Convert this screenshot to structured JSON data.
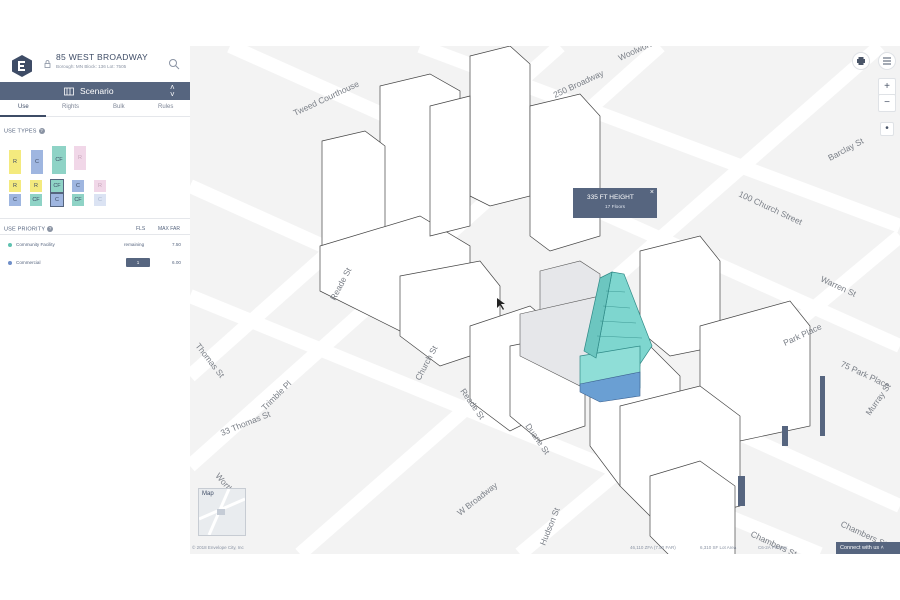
{
  "header": {
    "address": "85 WEST BROADWAY",
    "meta": "Borough: MN   Block: 136   Lot: 7505"
  },
  "scenario": {
    "label": "Scenario"
  },
  "tabs": [
    {
      "label": "Use",
      "active": true
    },
    {
      "label": "Rights",
      "active": false
    },
    {
      "label": "Bulk",
      "active": false
    },
    {
      "label": "Rules",
      "active": false
    }
  ],
  "use_types": {
    "title": "USE TYPES",
    "row1": [
      "R",
      "C",
      "CF",
      "R"
    ],
    "row2_top": [
      "R",
      "R",
      "CF",
      "C",
      "R"
    ],
    "row2_bottom": [
      "C",
      "CF",
      "C",
      "CF",
      "C"
    ]
  },
  "use_priority": {
    "title": "USE PRIORITY",
    "col_flr": "FLS",
    "col_far": "MAX FAR",
    "rows": [
      {
        "name": "Community Facility",
        "value": "remaining",
        "far": "7.50",
        "color": "#5fc2b0"
      },
      {
        "name": "Commercial",
        "value": "1",
        "far": "6.00",
        "color": "#6f8fc8"
      }
    ]
  },
  "tooltip": {
    "height": "335 FT HEIGHT",
    "floors": "17 Floors",
    "close": "×"
  },
  "map_controls": {
    "print": "print-icon",
    "menu": "menu-icon",
    "zoom_in": "+",
    "zoom_out": "−",
    "locate": "•"
  },
  "minimap": {
    "label": "Map"
  },
  "streets": {
    "reade_st_1": "Reade St",
    "reade_st_2": "Reade St",
    "church_st": "Church St",
    "duane_st": "Duane St",
    "thomas_st": "Thomas St",
    "trimble_pl": "Trimble Pl",
    "worth_st": "Worth St",
    "w_broadway": "W Broadway",
    "hudson_st": "Hudson St",
    "chambers_st_1": "Chambers St",
    "chambers_st_2": "Chambers St",
    "park_place": "Park Place",
    "murray_st": "Murray St",
    "warren_st": "Warren St",
    "broadway": "250 Broadway",
    "church_100": "100 Church Street",
    "barclay_st": "Barclay St",
    "woolworth": "Woolworth",
    "tweed": "Tweed Courthouse",
    "thomas_33": "33 Thomas St",
    "park_75": "75 Park Place"
  },
  "footer": {
    "copyright": "© 2018 Envelope City, Inc",
    "zfa": "46,110 ZFA (7.50 FAR)",
    "lot_area": "6,310 SF Lot Area",
    "zoning": "C6-2A Primary",
    "connect": "Connect with us"
  },
  "colors": {
    "panel_accent": "#56657f",
    "tower": "#7ed6cf",
    "residential": "#f4ea7e",
    "commercial": "#9fb6e0",
    "community": "#8fd3c6",
    "pink": "#f1d7e8"
  }
}
